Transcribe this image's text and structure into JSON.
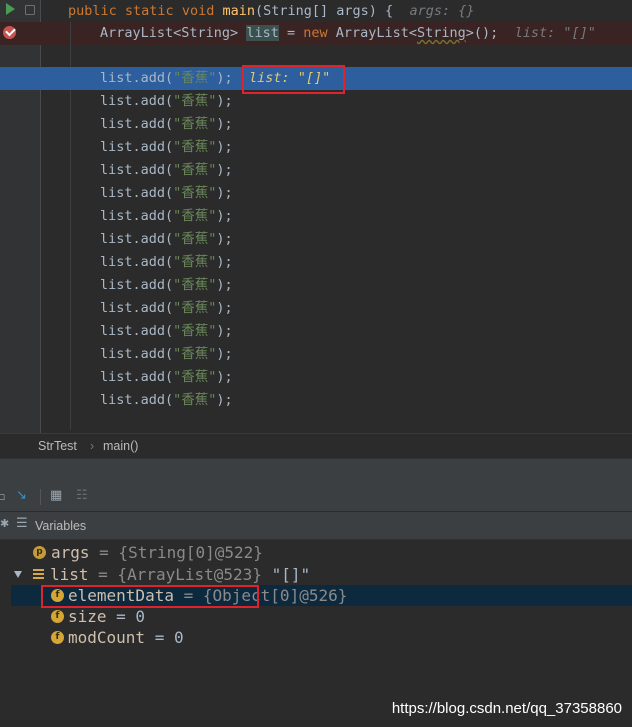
{
  "editor": {
    "line1": {
      "kw1": "public",
      "kw2": "static",
      "kw3": "void",
      "method": "main",
      "params": "(String[] args) {",
      "hint": "args: {}"
    },
    "line2": {
      "type": "ArrayList<String> ",
      "var": "list",
      "eq": " = ",
      "kw_new": "new",
      "ctor": " ArrayList<",
      "generic": "String",
      "end": ">();",
      "hint": "list: \"[]\""
    },
    "add_call_prefix": "list.add(",
    "add_arg": "\"香蕉\"",
    "add_call_suffix": ");",
    "exec_hint": "list: \"[]\"",
    "add_line_count": 15
  },
  "breadcrumb": {
    "class_name": "StrTest",
    "separator": "›",
    "method_name": "main()"
  },
  "variables_panel": {
    "title": "Variables"
  },
  "variables": [
    {
      "badge": "p",
      "name": "args",
      "value": " = {String[0]@522}"
    },
    {
      "name": "list",
      "value": " = {ArrayList@523} ",
      "display": "\"[]\""
    },
    {
      "badge": "f",
      "name": "elementData",
      "value": " = {Object[0]@526}"
    },
    {
      "badge": "f",
      "name": "size",
      "value": " = 0"
    },
    {
      "badge": "f",
      "name": "modCount",
      "value": " = 0"
    }
  ],
  "watermark": "https://blog.csdn.net/qq_37358860"
}
